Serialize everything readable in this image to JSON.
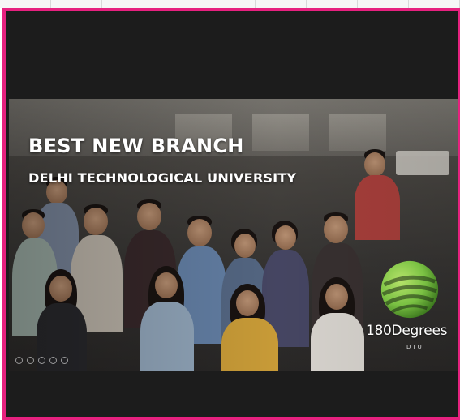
{
  "video": {
    "title": "BEST NEW BRANCH",
    "subtitle": "DELHI TECHNOLOGICAL UNIVERSITY",
    "logo_name": "180Degrees",
    "logo_sub": "DTU"
  },
  "colors": {
    "frame_border": "#e6217f",
    "frame_bg": "#1c1c1c",
    "logo_green": "#7ac143"
  },
  "icons": [
    "play-icon",
    "volume-icon",
    "settings-icon",
    "captions-icon",
    "fullscreen-icon"
  ]
}
